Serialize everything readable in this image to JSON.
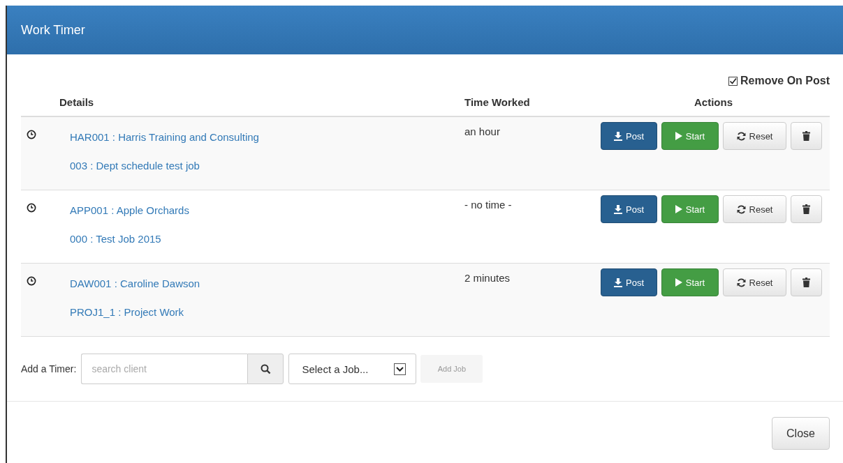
{
  "window": {
    "title": "Work Timer"
  },
  "remove_on_post": {
    "label": "Remove On Post",
    "checked": true
  },
  "table": {
    "columns": [
      "Details",
      "Time Worked",
      "Actions"
    ],
    "rows": [
      {
        "client": "HAR001 : Harris Training and Consulting",
        "job": "003 : Dept schedule test job",
        "time_worked": "an hour",
        "actions": [
          {
            "kind": "post",
            "label": "Post"
          },
          {
            "kind": "start",
            "label": "Start"
          },
          {
            "kind": "reset",
            "label": "Reset"
          },
          {
            "kind": "delete"
          }
        ]
      },
      {
        "client": "APP001 : Apple Orchards",
        "job": "000 : Test Job 2015",
        "time_worked": "- no time -",
        "actions": [
          {
            "kind": "post",
            "label": "Post"
          },
          {
            "kind": "start",
            "label": "Start"
          },
          {
            "kind": "reset",
            "label": "Reset"
          },
          {
            "kind": "delete"
          }
        ]
      },
      {
        "client": "DAW001 : Caroline Dawson",
        "job": "PROJ1_1 : Project Work",
        "time_worked": "2 minutes",
        "actions": [
          {
            "kind": "post",
            "label": "Post"
          },
          {
            "kind": "start",
            "label": "Start"
          },
          {
            "kind": "reset",
            "label": "Reset"
          },
          {
            "kind": "delete"
          }
        ]
      }
    ]
  },
  "add_timer": {
    "label": "Add a Timer:",
    "search": {
      "placeholder": "search client"
    },
    "job_select": {
      "value": "Select a Job..."
    },
    "add_button": {
      "label": "Add Job",
      "disabled": true
    }
  },
  "footer": {
    "buttons": [
      "Close"
    ]
  }
}
